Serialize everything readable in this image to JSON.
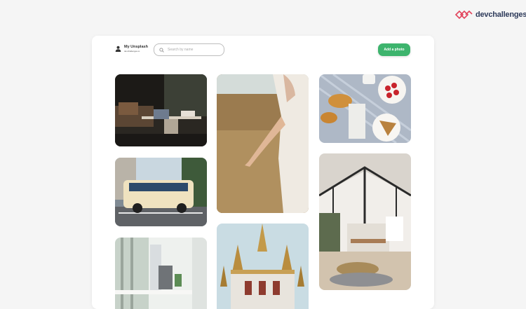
{
  "brand": {
    "name": "devchallenges",
    "icon": "devchallenges-logo-icon"
  },
  "app": {
    "title": "My Unsplash",
    "subtitle": "devchallenges.io",
    "icon": "user-icon"
  },
  "search": {
    "placeholder": "Search by name",
    "value": "",
    "icon": "search-icon"
  },
  "actions": {
    "add_photo_label": "Add a photo"
  },
  "colors": {
    "accent": "#3db46d",
    "brand": "#2d3a5a",
    "background": "#f5f5f5"
  },
  "photos": [
    {
      "subject": "living room with laptop on table"
    },
    {
      "subject": "woman touching wheat field"
    },
    {
      "subject": "croissants, strawberries and milk carton"
    },
    {
      "subject": "cream vintage van on street"
    },
    {
      "subject": "open plan loft interior"
    },
    {
      "subject": "bright desk with computer"
    },
    {
      "subject": "ornate temple roofs"
    }
  ]
}
